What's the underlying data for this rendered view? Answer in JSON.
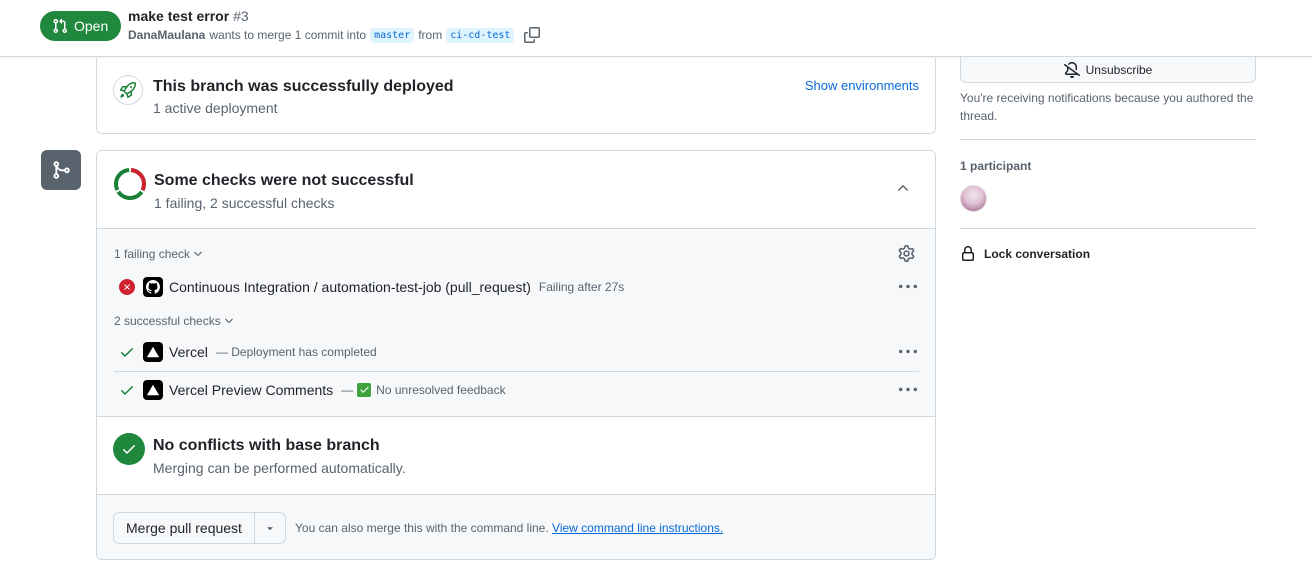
{
  "header": {
    "state_label": "Open",
    "title": "make test error",
    "number": "#3",
    "author": "DanaMaulana",
    "merge_text": "wants to merge 1 commit into",
    "base_branch": "master",
    "from_text": "from",
    "head_branch": "ci-cd-test"
  },
  "deployment": {
    "title": "This branch was successfully deployed",
    "subtitle": "1 active deployment",
    "show_environments": "Show environments"
  },
  "checks": {
    "title": "Some checks were not successful",
    "subtitle": "1 failing, 2 successful checks",
    "failing_group_label": "1 failing check",
    "successful_group_label": "2 successful checks",
    "failing": [
      {
        "name": "Continuous Integration / automation-test-job (pull_request)",
        "description": "Failing after 27s"
      }
    ],
    "successful": [
      {
        "name": "Vercel",
        "description": "— Deployment has completed"
      },
      {
        "name": "Vercel Preview Comments",
        "description_prefix": "—",
        "description": "No unresolved feedback"
      }
    ],
    "colors": {
      "fail": "#cf222e",
      "success": "#1a7f37"
    }
  },
  "merge": {
    "status_title": "No conflicts with base branch",
    "status_subtitle": "Merging can be performed automatically.",
    "button_label": "Merge pull request",
    "hint_text": "You can also merge this with the command line.",
    "hint_link": "View command line instructions."
  },
  "sidebar": {
    "unsubscribe_label": "Unsubscribe",
    "notification_text": "You're receiving notifications because you authored the thread.",
    "participants_label": "1 participant",
    "lock_label": "Lock conversation"
  },
  "colors": {
    "open_green": "#1f883d",
    "link_blue": "#0969da",
    "muted": "#59636e",
    "border": "#d1d9e0"
  }
}
